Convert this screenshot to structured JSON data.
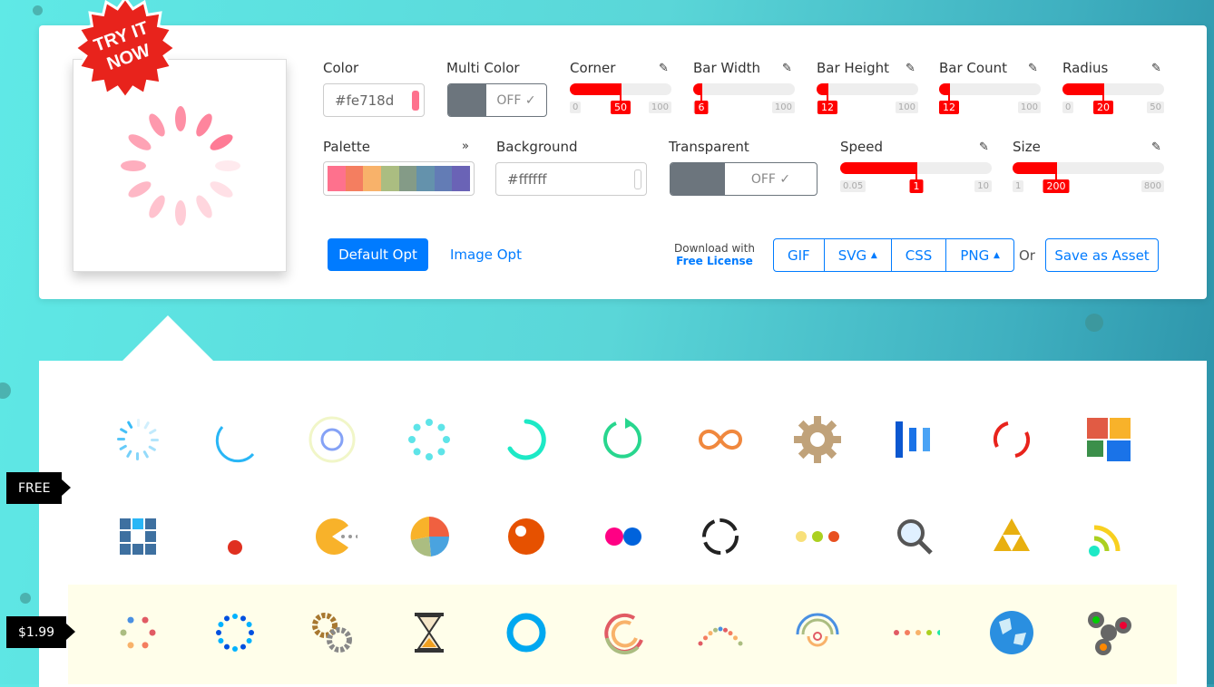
{
  "badge": "TRY IT NOW",
  "controls": {
    "color": {
      "label": "Color",
      "value": "#fe718d"
    },
    "multi_color": {
      "label": "Multi Color",
      "value": "OFF"
    },
    "corner": {
      "label": "Corner",
      "min": "0",
      "value": "50",
      "max": "100"
    },
    "bar_width": {
      "label": "Bar Width",
      "min": "1",
      "value": "6",
      "max": "100"
    },
    "bar_height": {
      "label": "Bar Height",
      "min": "1",
      "value": "12",
      "max": "100"
    },
    "bar_count": {
      "label": "Bar Count",
      "min": "2",
      "value": "12",
      "max": "100"
    },
    "radius": {
      "label": "Radius",
      "min": "0",
      "value": "20",
      "max": "50"
    },
    "palette": {
      "label": "Palette",
      "colors": [
        "#fe718d",
        "#f47e60",
        "#f8b26a",
        "#abbd81",
        "#849b87",
        "#6492ac",
        "#637cb5",
        "#6a63b6"
      ]
    },
    "background": {
      "label": "Background",
      "value": "#ffffff"
    },
    "transparent": {
      "label": "Transparent",
      "value": "OFF"
    },
    "speed": {
      "label": "Speed",
      "min": "0.05",
      "value": "1",
      "max": "10"
    },
    "size": {
      "label": "Size",
      "min": "1",
      "value": "200",
      "max": "800"
    }
  },
  "actions": {
    "default_opt": "Default Opt",
    "image_opt": "Image Opt",
    "download_with": "Download with",
    "free_license": "Free License",
    "gif": "GIF",
    "svg": "SVG",
    "css": "CSS",
    "png": "PNG",
    "or": "Or",
    "save_asset": "Save as Asset"
  },
  "tags": {
    "free": "FREE",
    "paid": "$1.99"
  },
  "accent": "#007bff",
  "icons": [
    [
      "spinner-blue",
      "ring-arc",
      "double-ring",
      "dots-spinner",
      "arc-teal",
      "rotate-green",
      "infinity",
      "gear",
      "bars-blue",
      "dual-arc-red",
      "squares-colorful"
    ],
    [
      "grid-blue",
      "bouncing-dot",
      "pacman",
      "pie",
      "ball-orange",
      "flickr-dots",
      "circle-dashes",
      "ellipsis",
      "magnifier",
      "triangles",
      "wifi"
    ],
    [
      "dots-colorful",
      "dots-circle",
      "gears",
      "hourglass",
      "ring-blue",
      "arcs-colorful",
      "wave-dots",
      "radar",
      "dots-line",
      "globe",
      "fidget"
    ]
  ]
}
